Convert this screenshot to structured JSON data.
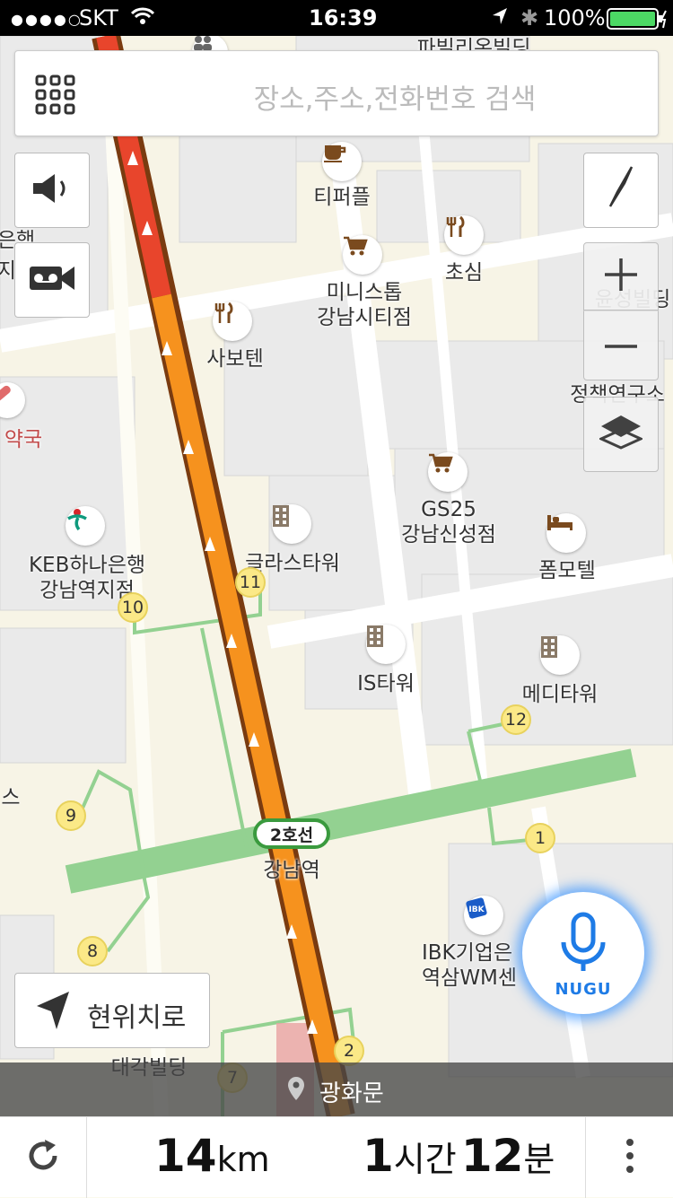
{
  "status_bar": {
    "carrier": "SKT",
    "time": "16:39",
    "battery": "100%"
  },
  "search": {
    "placeholder": "장소,주소,전화번호 검색",
    "menu_icon": "grid-menu-icon"
  },
  "controls": {
    "sound": "speaker-icon",
    "record": "video-camera-icon",
    "compass": "compass-icon",
    "zoom_in": "plus-icon",
    "zoom_out": "minus-icon",
    "layers": "layers-icon"
  },
  "map": {
    "background_labels": [
      {
        "id": "top-building",
        "text": "파빌리온빌딩"
      },
      {
        "id": "yunseong",
        "text": "윤성빌딩"
      },
      {
        "id": "policy",
        "text": "정책연구소"
      },
      {
        "id": "eunhaeng",
        "text": "은행"
      },
      {
        "id": "jijeom",
        "text": "지점"
      },
      {
        "id": "yakguk",
        "text": "약국"
      },
      {
        "id": "seu",
        "text": "스"
      }
    ],
    "pois": [
      {
        "id": "tipeople",
        "text": "티퍼플",
        "icon": "coffee-icon"
      },
      {
        "id": "chosim",
        "text": "초심",
        "icon": "restaurant-icon"
      },
      {
        "id": "ministop",
        "text": "미니스톱\n강남시티점",
        "icon": "cart-icon"
      },
      {
        "id": "saboten",
        "text": "사보텐",
        "icon": "restaurant-icon"
      },
      {
        "id": "gs25",
        "text": "GS25\n강남신성점",
        "icon": "cart-icon"
      },
      {
        "id": "keb",
        "text": "KEB하나은행\n강남역지점",
        "icon": "bank-logo-icon"
      },
      {
        "id": "glass",
        "text": "글라스타워",
        "icon": "building-icon"
      },
      {
        "id": "pommotel",
        "text": "폼모텔",
        "icon": "bed-icon"
      },
      {
        "id": "istower",
        "text": "IS타워",
        "icon": "building-icon"
      },
      {
        "id": "meditower",
        "text": "메디타워",
        "icon": "building-icon"
      },
      {
        "id": "ibk",
        "text": "IBK기업은\n역삼WM센",
        "icon": "ibk-logo-icon"
      },
      {
        "id": "daegak",
        "text": "대각빌딩",
        "icon": ""
      }
    ],
    "exits": [
      "11",
      "10",
      "12",
      "9",
      "1",
      "8",
      "2",
      "7"
    ],
    "station": {
      "line": "2호선",
      "name": "강남역"
    },
    "route_colors": {
      "congested": "#e8452c",
      "slow": "#f6921e",
      "subway": "#93d191"
    }
  },
  "current_location_button": {
    "label": "현위치로",
    "icon": "location-arrow-icon"
  },
  "voice": {
    "label": "NUGU",
    "icon": "microphone-icon"
  },
  "destination": {
    "label": "광화문",
    "icon": "pin-icon"
  },
  "trip": {
    "distance_value": "14",
    "distance_unit": "km",
    "time_hours": "1",
    "time_hours_unit": "시간",
    "time_minutes": "12",
    "time_minutes_unit": "분",
    "refresh_icon": "refresh-icon",
    "more_icon": "more-vertical-icon"
  }
}
